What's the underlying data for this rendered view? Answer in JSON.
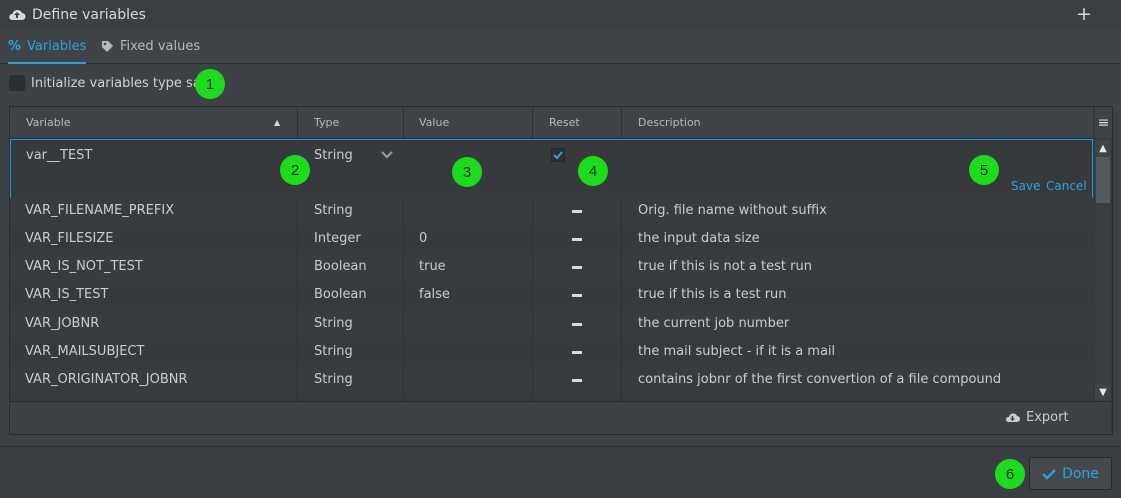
{
  "window": {
    "title": "Define variables"
  },
  "tabs": [
    {
      "label": "Variables"
    },
    {
      "label": "Fixed values"
    }
  ],
  "init": {
    "label": "Initialize variables type save"
  },
  "columns": {
    "variable": "Variable",
    "type": "Type",
    "value": "Value",
    "reset": "Reset",
    "description": "Description"
  },
  "edit_row": {
    "variable": "var__TEST",
    "type": "String",
    "value": "",
    "reset_checked": true,
    "save_label": "Save",
    "cancel_label": "Cancel"
  },
  "rows": [
    {
      "variable": "VAR_FILENAME_PREFIX",
      "type": "String",
      "value": "",
      "description": "Orig. file name without suffix"
    },
    {
      "variable": "VAR_FILESIZE",
      "type": "Integer",
      "value": "0",
      "description": "the input data size"
    },
    {
      "variable": "VAR_IS_NOT_TEST",
      "type": "Boolean",
      "value": "true",
      "description": "true if this is not a test run"
    },
    {
      "variable": "VAR_IS_TEST",
      "type": "Boolean",
      "value": "false",
      "description": "true if this is a test run"
    },
    {
      "variable": "VAR_JOBNR",
      "type": "String",
      "value": "",
      "description": "the current job number"
    },
    {
      "variable": "VAR_MAILSUBJECT",
      "type": "String",
      "value": "",
      "description": "the mail subject - if it is a mail"
    },
    {
      "variable": "VAR_ORIGINATOR_JOBNR",
      "type": "String",
      "value": "",
      "description": "contains jobnr of the first convertion of a file compound"
    }
  ],
  "footer": {
    "export_label": "Export"
  },
  "done": {
    "label": "Done"
  },
  "badges": [
    "1",
    "2",
    "3",
    "4",
    "5",
    "6"
  ],
  "colors": {
    "accent": "#29a3d8",
    "badge": "#1ddc1d"
  }
}
